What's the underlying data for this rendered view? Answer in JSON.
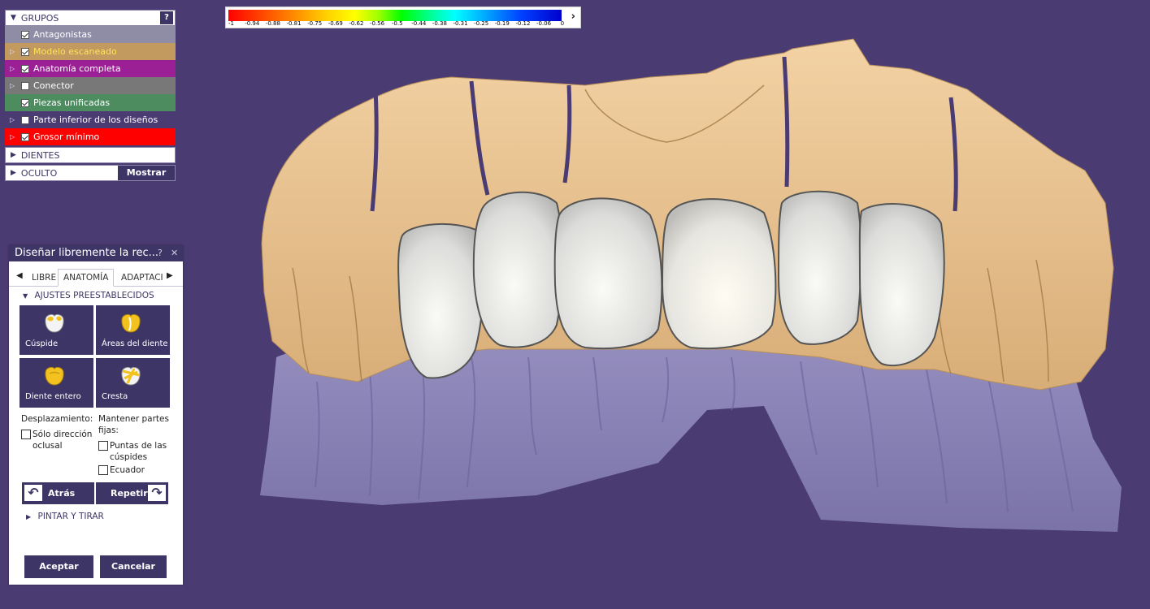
{
  "groups": {
    "title": "GRUPOS",
    "help": "?",
    "items": [
      {
        "label": "Antagonistas",
        "checked": true,
        "expandable": false,
        "bg": "#8f8ca6",
        "fg": "#ffffff"
      },
      {
        "label": "Modelo escaneado",
        "checked": true,
        "expandable": true,
        "bg": "#c29a60",
        "fg": "#ffe25a"
      },
      {
        "label": "Anatomía completa",
        "checked": true,
        "expandable": true,
        "bg": "#9b1f95",
        "fg": "#ffffff"
      },
      {
        "label": "Conector",
        "checked": false,
        "expandable": true,
        "bg": "#787878",
        "fg": "#ffffff"
      },
      {
        "label": "Piezas unificadas",
        "checked": true,
        "expandable": false,
        "bg": "#4c8c5f",
        "fg": "#ffffff"
      },
      {
        "label": "Parte inferior de los diseños",
        "checked": false,
        "expandable": true,
        "bg": "#4a3b72",
        "fg": "#ffffff"
      },
      {
        "label": "Grosor mínimo",
        "checked": true,
        "expandable": true,
        "bg": "#ff0000",
        "fg": "#ffffff"
      }
    ],
    "teeth": "DIENTES",
    "hidden": "OCULTO",
    "show_button": "Mostrar"
  },
  "scale": {
    "ticks": [
      "-1",
      "-0.94",
      "-0.88",
      "-0.81",
      "-0.75",
      "-0.69",
      "-0.62",
      "-0.56",
      "-0.5",
      "-0.44",
      "-0.38",
      "-0.31",
      "-0.25",
      "-0.19",
      "-0.12",
      "-0.06",
      "0"
    ]
  },
  "dialog": {
    "title": "Diseñar libremente la rec...",
    "help": "?",
    "close": "✕",
    "tabs": [
      "LIBRE",
      "ANATOMÍA",
      "ADAPTACIÓ"
    ],
    "active_tab": "ANATOMÍA",
    "presets_title": "AJUSTES PREESTABLECIDOS",
    "presets": [
      {
        "label": "Cúspide",
        "selected": true
      },
      {
        "label": "Áreas del diente",
        "selected": false
      },
      {
        "label": "Diente entero",
        "selected": false
      },
      {
        "label": "Cresta",
        "selected": false
      }
    ],
    "displacement_label": "Desplazamiento:",
    "occlusal_only": "Sólo dirección oclusal",
    "keep_parts_label": "Mantener partes fijas:",
    "cusp_tips": "Puntas de las cúspides",
    "equator": "Ecuador",
    "back": "Atrás",
    "redo": "Repetir",
    "paint_pull": "PINTAR Y TIRAR",
    "accept": "Aceptar",
    "cancel": "Cancelar"
  },
  "colors": {
    "background": "#4a3b72",
    "accent": "#3d3565",
    "selected_preset": "#ee8a57",
    "model": "#f0cc9c",
    "crowns": "#e6e6e4",
    "antagonist": "#8d86b8"
  }
}
